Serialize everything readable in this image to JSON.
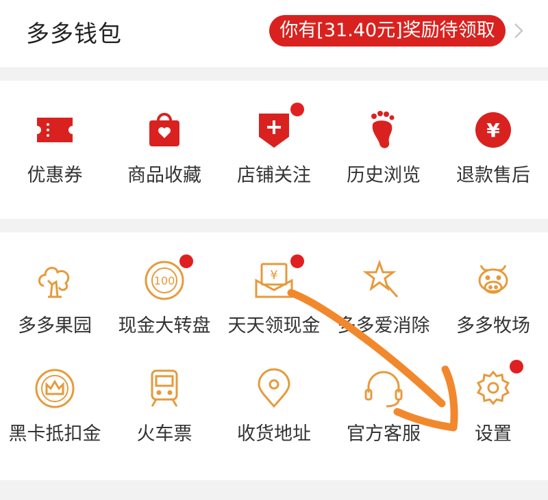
{
  "wallet": {
    "title": "多多钱包",
    "reward_text": "你有[31.40元]奖励待领取"
  },
  "section1": [
    {
      "label": "优惠券",
      "icon": "coupon-icon",
      "dot": false
    },
    {
      "label": "商品收藏",
      "icon": "favorite-bag-icon",
      "dot": false
    },
    {
      "label": "店铺关注",
      "icon": "store-follow-icon",
      "dot": true
    },
    {
      "label": "历史浏览",
      "icon": "footprint-icon",
      "dot": false
    },
    {
      "label": "退款售后",
      "icon": "refund-icon",
      "dot": false
    }
  ],
  "section2": [
    {
      "label": "多多果园",
      "icon": "tree-icon",
      "dot": false
    },
    {
      "label": "现金大转盘",
      "icon": "wheel-100-icon",
      "dot": true
    },
    {
      "label": "天天领现金",
      "icon": "cash-envelope-icon",
      "dot": true
    },
    {
      "label": "多多爱消除",
      "icon": "star-wand-icon",
      "dot": false
    },
    {
      "label": "多多牧场",
      "icon": "cow-icon",
      "dot": false
    },
    {
      "label": "黑卡抵扣金",
      "icon": "crown-coin-icon",
      "dot": false
    },
    {
      "label": "火车票",
      "icon": "train-icon",
      "dot": false
    },
    {
      "label": "收货地址",
      "icon": "location-pin-icon",
      "dot": false
    },
    {
      "label": "官方客服",
      "icon": "headset-icon",
      "dot": false
    },
    {
      "label": "设置",
      "icon": "gear-icon",
      "dot": true
    }
  ],
  "colors": {
    "accent": "#d9221f",
    "icon_orange": "#e69a3b"
  }
}
